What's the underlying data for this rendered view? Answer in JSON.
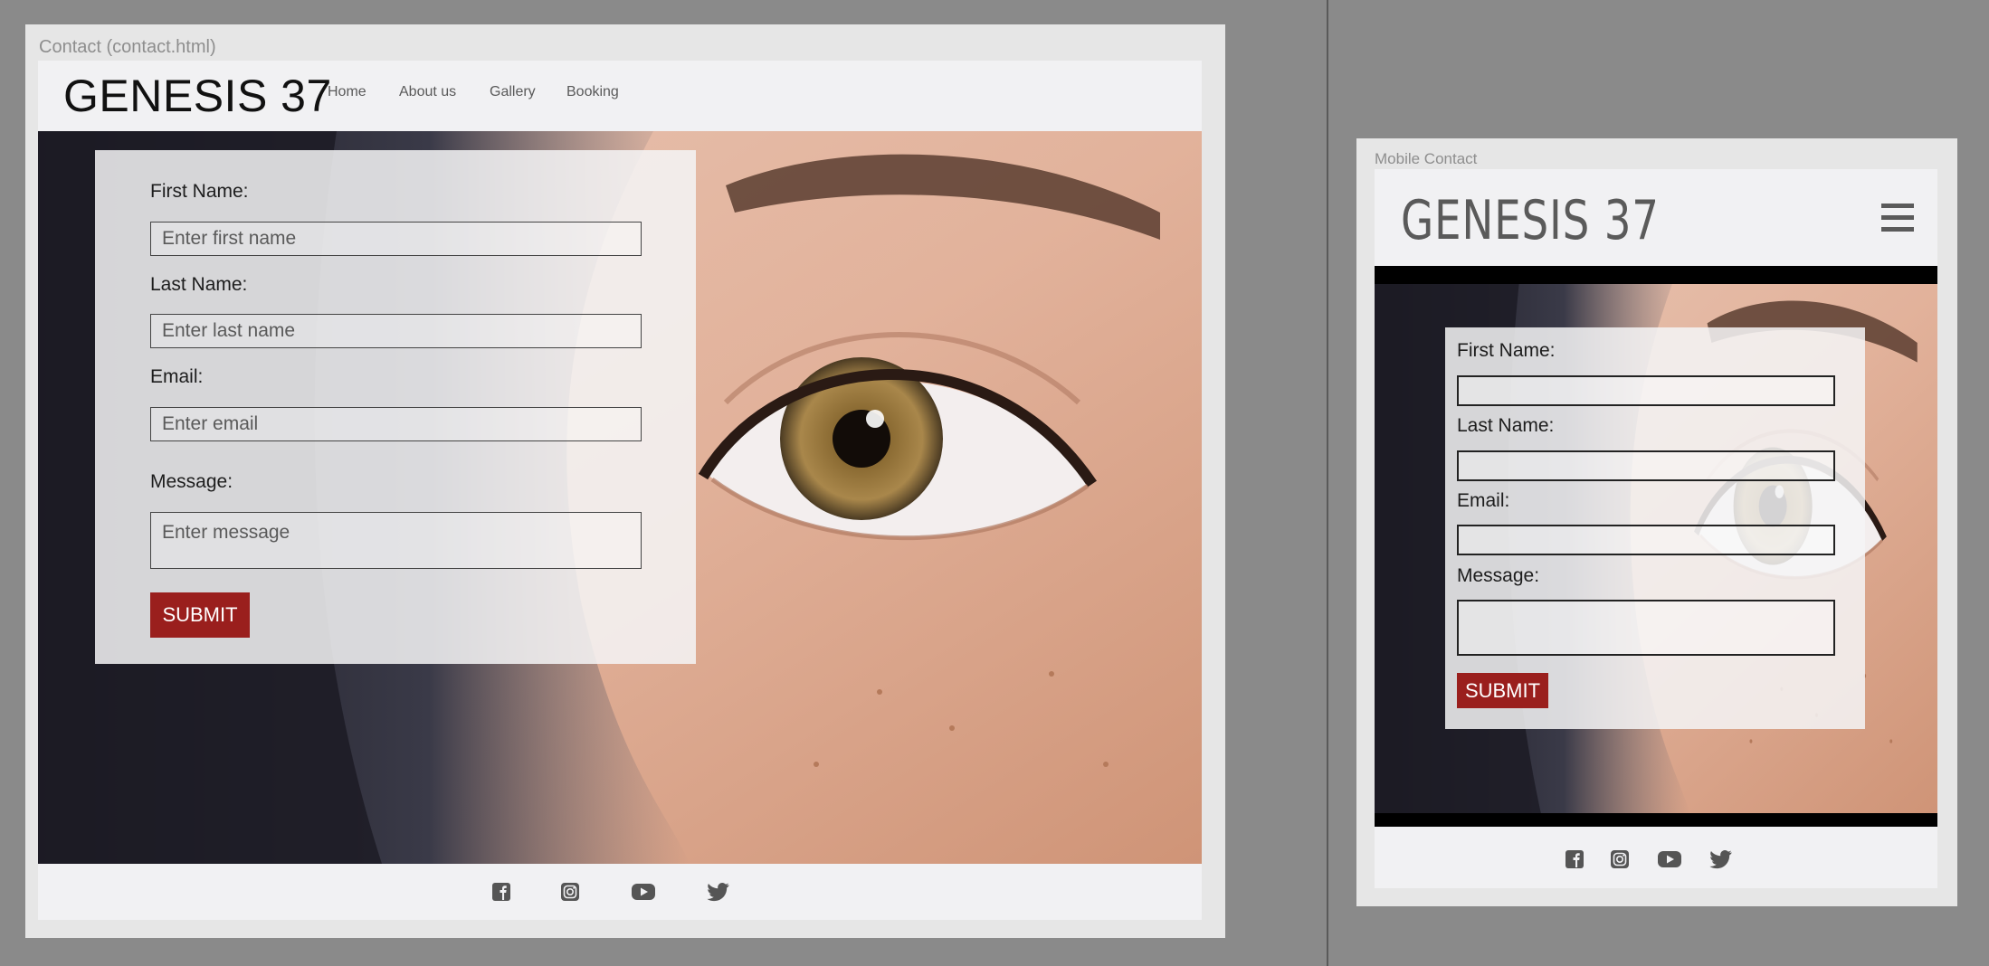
{
  "desktop": {
    "artboard_label": "Contact (contact.html)",
    "logo": "GENESIS 37",
    "nav": [
      "Home",
      "About us",
      "Gallery",
      "Booking"
    ],
    "form": {
      "first_label": "First Name:",
      "first_placeholder": "Enter first name",
      "last_label": "Last Name:",
      "last_placeholder": "Enter last name",
      "email_label": "Email:",
      "email_placeholder": "Enter email",
      "message_label": "Message:",
      "message_placeholder": "Enter message",
      "submit": "SUBMIT"
    },
    "social_icons": [
      "facebook-icon",
      "instagram-icon",
      "youtube-icon",
      "twitter-icon"
    ]
  },
  "mobile": {
    "artboard_label": "Mobile Contact",
    "logo": "GENESIS 37",
    "menu_icon": "hamburger-icon",
    "form": {
      "first_label": "First Name:",
      "last_label": "Last Name:",
      "email_label": "Email:",
      "message_label": "Message:",
      "submit": "SUBMIT"
    },
    "social_icons": [
      "facebook-icon",
      "instagram-icon",
      "youtube-icon",
      "twitter-icon"
    ]
  },
  "colors": {
    "canvas": "#8a8a8a",
    "artboard": "#e6e6e6",
    "navbar": "#f1f1f3",
    "accent": "#9a1f1d"
  }
}
